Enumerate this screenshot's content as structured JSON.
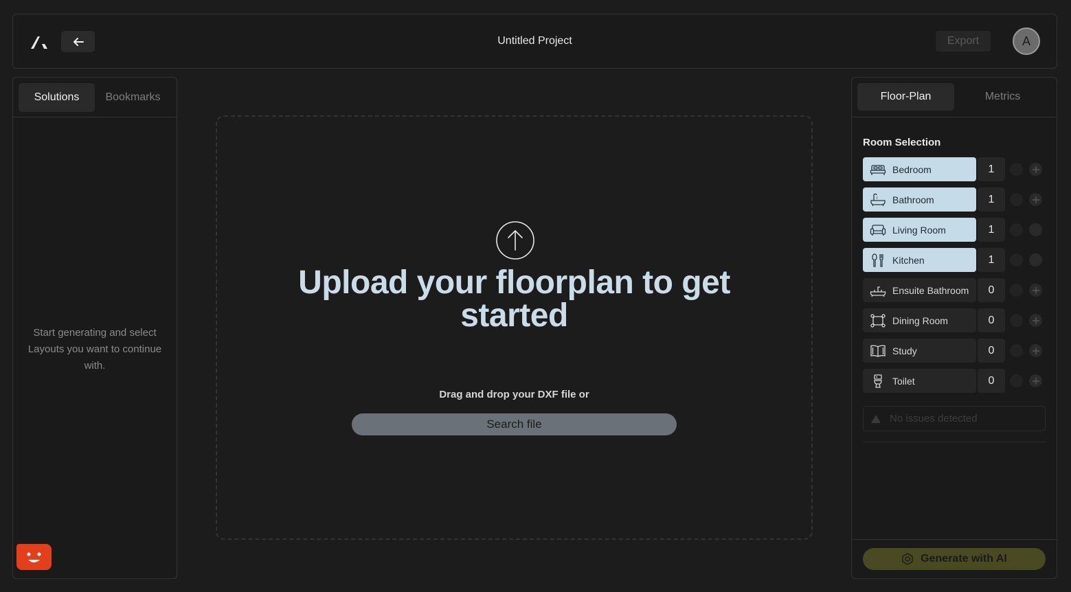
{
  "header": {
    "project_title": "Untitled Project",
    "export_label": "Export",
    "avatar_initial": "A"
  },
  "left_panel": {
    "tabs": [
      {
        "label": "Solutions",
        "active": true
      },
      {
        "label": "Bookmarks",
        "active": false
      }
    ],
    "empty_message": "Start generating and select Layouts you want to continue with."
  },
  "upload": {
    "title": "Upload your floorplan to get started",
    "drag_text": "Drag and drop your DXF file or",
    "search_label": "Search file"
  },
  "right_panel": {
    "tabs": [
      {
        "label": "Floor-Plan",
        "active": true
      },
      {
        "label": "Metrics",
        "active": false
      }
    ],
    "heading": "Room Selection",
    "rooms": [
      {
        "name": "Bedroom",
        "count": "1",
        "icon": "bed-icon",
        "selected": true
      },
      {
        "name": "Bathroom",
        "count": "1",
        "icon": "bathtub-icon",
        "selected": true
      },
      {
        "name": "Living Room",
        "count": "1",
        "icon": "sofa-icon",
        "selected": true
      },
      {
        "name": "Kitchen",
        "count": "1",
        "icon": "utensils-icon",
        "selected": true
      },
      {
        "name": "Ensuite Bathroom",
        "count": "0",
        "icon": "ensuite-bath-icon",
        "selected": false
      },
      {
        "name": "Dining Room",
        "count": "0",
        "icon": "dining-table-icon",
        "selected": false
      },
      {
        "name": "Study",
        "count": "0",
        "icon": "book-icon",
        "selected": false
      },
      {
        "name": "Toilet",
        "count": "0",
        "icon": "toilet-icon",
        "selected": false
      }
    ],
    "issues_text": "No issues detected",
    "generate_label": "Generate with AI"
  },
  "colors": {
    "background": "#1c1c1c",
    "selected_room": "#c6dbe8",
    "upload_title": "#c9dce8",
    "generate_button": "#4a4a22",
    "bot_badge": "#e43f1c"
  }
}
